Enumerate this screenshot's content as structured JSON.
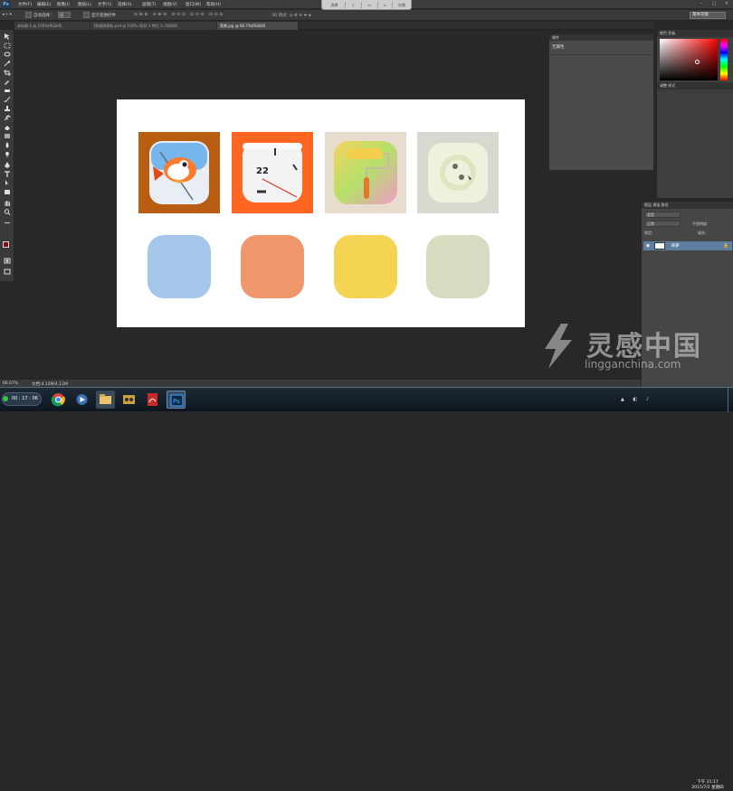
{
  "app": {
    "logo": "Ps"
  },
  "menubar": {
    "items": [
      "文件(F)",
      "编辑(E)",
      "图像(I)",
      "图层(L)",
      "文字(Y)",
      "选择(S)",
      "滤镜(T)",
      "视图(V)",
      "窗口(W)",
      "帮助(H)"
    ]
  },
  "centerbar": {
    "buttons": [
      "选择",
      "",
      "",
      "",
      "仅限"
    ]
  },
  "options": {
    "auto_select": "自动选择：",
    "auto_select_value": "组",
    "show_transform": "显示变换控件",
    "workspace": "基本功能"
  },
  "tabs": [
    {
      "label": "未标题-1 @ 100%(RGB/8)"
    },
    {
      "label": "3款精致图标.psd @ 100% (形状 1 拷贝 3, RGB/8)"
    },
    {
      "label": "背景.jpg @ 66.7%(RGB/8)",
      "active": true
    }
  ],
  "properties": {
    "tab": "属性",
    "label": "无属性"
  },
  "color_panel": {
    "tabs": "颜色   色板"
  },
  "adjust_panel": {
    "tabs": "调整   样式"
  },
  "layers_panel": {
    "tabs": "图层   通道   路径",
    "kind": "类型",
    "blend": "正常",
    "opacity": "不透明度:",
    "lock": "锁定:",
    "fill": "填充:",
    "layer_name": "背景"
  },
  "status": {
    "zoom": "66.67%",
    "doc": "文档:4.12M/4.12M"
  },
  "taskbar": {
    "start": "00 : 17 : 06"
  },
  "clock": {
    "time": "下午 21:17",
    "date": "2015/7/2 星期四"
  },
  "watermark": {
    "brand": "灵感中国",
    "url": "lingganchina.com"
  },
  "colors": {
    "sq1": "#a4c6ea",
    "sq2": "#f0966d",
    "sq3": "#f5d454",
    "sq4": "#d5dcc0",
    "tile_clock_bg": "#ff6622",
    "tile_fish_bg": "#b85d12"
  },
  "icons": [
    "koi-fish-icon",
    "clock-app-icon",
    "paint-roller-icon",
    "power-socket-icon"
  ],
  "clock_icon": {
    "number": "22"
  }
}
